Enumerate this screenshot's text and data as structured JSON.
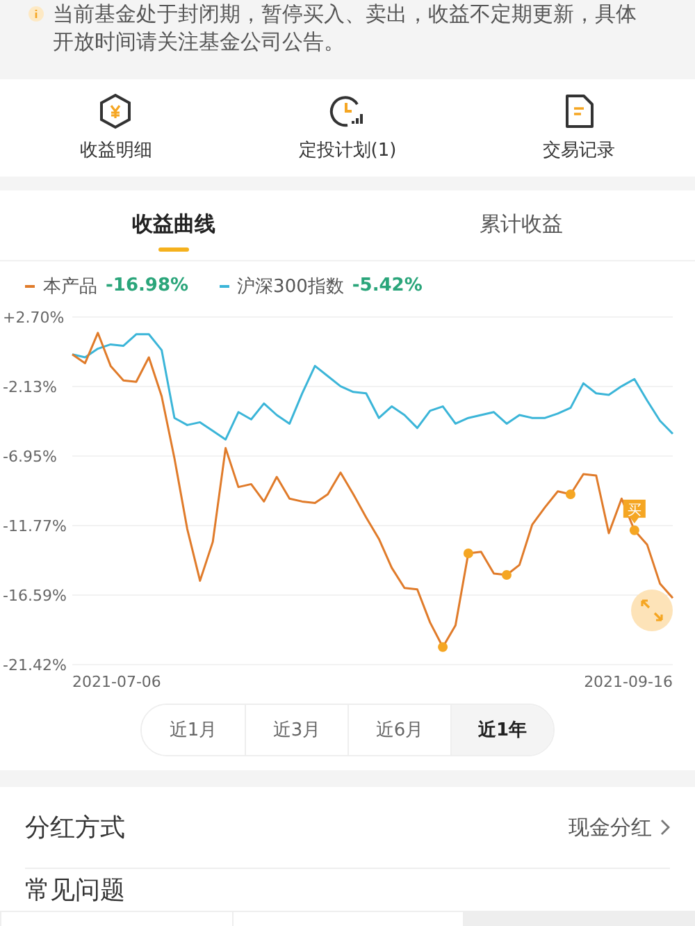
{
  "notice": {
    "text": "当前基金处于封闭期，暂停买入、卖出，收益不定期更新，具体开放时间请关注基金公司公告。"
  },
  "shortcuts": [
    {
      "kind": "earnings",
      "label": "收益明细"
    },
    {
      "kind": "plan",
      "label": "定投计划(1)"
    },
    {
      "kind": "records",
      "label": "交易记录"
    }
  ],
  "tabs": [
    {
      "label": "收益曲线",
      "selected": true
    },
    {
      "label": "累计收益",
      "selected": false
    }
  ],
  "legend_readings": [
    "-16.98%",
    "-5.42%"
  ],
  "chart_data": {
    "type": "line",
    "grid": true,
    "ylim": [
      -21.42,
      2.7
    ],
    "yticks": [
      {
        "value": 2.7,
        "label": "+2.70%"
      },
      {
        "value": -2.13,
        "label": "-2.13%"
      },
      {
        "value": -6.95,
        "label": "-6.95%"
      },
      {
        "value": -11.77,
        "label": "-11.77%"
      },
      {
        "value": -16.59,
        "label": "-16.59%"
      },
      {
        "value": -21.42,
        "label": "-21.42%"
      }
    ],
    "series": [
      {
        "name": "本产品",
        "color": "#e07b2a",
        "values": [
          0.1,
          -0.5,
          1.6,
          -0.7,
          -1.7,
          -1.8,
          -0.1,
          -2.8,
          -7.1,
          -12,
          -15.6,
          -12.9,
          -6.4,
          -9.1,
          -8.9,
          -10.1,
          -8.4,
          -9.9,
          -10.1,
          -10.2,
          -9.6,
          -8.1,
          -9.6,
          -11.2,
          -12.7,
          -14.7,
          -16.1,
          -16.2,
          -18.5,
          -20.2,
          -18.7,
          -13.7,
          -13.6,
          -15.1,
          -15.2,
          -14.5,
          -11.7,
          -10.5,
          -9.4,
          -9.6,
          -8.2,
          -8.3,
          -12.3,
          -9.9,
          -12.1,
          -13.1,
          -15.8,
          -16.8
        ]
      },
      {
        "name": "沪深300指数",
        "color": "#3bb5d8",
        "values": [
          0.1,
          -0.1,
          0.5,
          0.8,
          0.7,
          1.5,
          1.5,
          0.4,
          -4.3,
          -4.8,
          -4.6,
          -5.2,
          -5.8,
          -3.9,
          -4.4,
          -3.3,
          -4.1,
          -4.7,
          -2.6,
          -0.7,
          -1.4,
          -2.1,
          -2.5,
          -2.6,
          -4.3,
          -3.5,
          -4.1,
          -5,
          -3.8,
          -3.5,
          -4.7,
          -4.3,
          -4.1,
          -3.9,
          -4.7,
          -4.1,
          -4.3,
          -4.3,
          -4,
          -3.6,
          -1.9,
          -2.6,
          -2.7,
          -2.1,
          -1.6,
          -3.1,
          -4.5,
          -5.4
        ]
      }
    ],
    "annotations": [
      {
        "text": "买"
      }
    ]
  },
  "x_labels": [
    "2021-07-06",
    "2021-09-16"
  ],
  "periods": [
    {
      "label": "近1月",
      "selected": false
    },
    {
      "label": "近3月",
      "selected": false
    },
    {
      "label": "近6月",
      "selected": false
    },
    {
      "label": "近1年",
      "selected": true
    }
  ],
  "rows": [
    {
      "label": "分红方式",
      "value": "现金分红"
    },
    {
      "label": "常见问题"
    }
  ]
}
